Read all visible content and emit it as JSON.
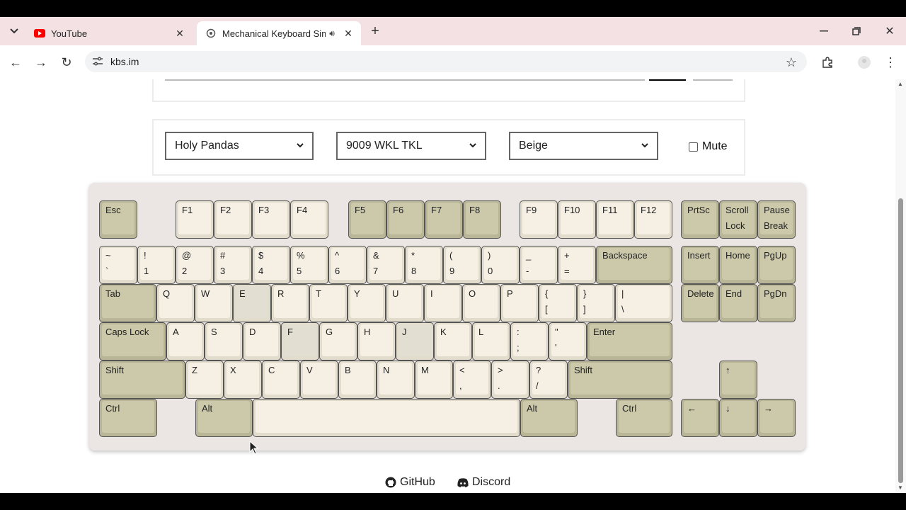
{
  "browser": {
    "tabs": [
      {
        "title": "YouTube",
        "icon": "youtube-icon"
      },
      {
        "title": "Mechanical Keyboard Simul",
        "icon": "keyboard-favicon-icon",
        "audio": true
      }
    ],
    "url": "kbs.im"
  },
  "controls": {
    "switch_select": "Holy Pandas",
    "layout_select": "9009 WKL TKL",
    "color_select": "Beige",
    "mute_label": "Mute",
    "mute_checked": false
  },
  "keyboard": {
    "colors": {
      "alpha": "#f6f0e4",
      "modifier": "#ccc9ab",
      "pressed": "#e2ded2"
    },
    "keys": [
      {
        "id": "esc",
        "t1": "Esc",
        "t2": ""
      },
      {
        "id": "f1",
        "t1": "F1",
        "t2": ""
      },
      {
        "id": "f2",
        "t1": "F2",
        "t2": ""
      },
      {
        "id": "f3",
        "t1": "F3",
        "t2": ""
      },
      {
        "id": "f4",
        "t1": "F4",
        "t2": ""
      },
      {
        "id": "f5",
        "t1": "F5",
        "t2": ""
      },
      {
        "id": "f6",
        "t1": "F6",
        "t2": ""
      },
      {
        "id": "f7",
        "t1": "F7",
        "t2": ""
      },
      {
        "id": "f8",
        "t1": "F8",
        "t2": ""
      },
      {
        "id": "f9",
        "t1": "F9",
        "t2": ""
      },
      {
        "id": "f10",
        "t1": "F10",
        "t2": ""
      },
      {
        "id": "f11",
        "t1": "F11",
        "t2": ""
      },
      {
        "id": "f12",
        "t1": "F12",
        "t2": ""
      },
      {
        "id": "prtsc",
        "t1": "PrtSc",
        "t2": ""
      },
      {
        "id": "scrolllock",
        "t1": "Scroll",
        "t2": "Lock"
      },
      {
        "id": "pause",
        "t1": "Pause",
        "t2": "Break"
      },
      {
        "id": "backtick",
        "t1": "~",
        "t2": "`"
      },
      {
        "id": "d1",
        "t1": "!",
        "t2": "1"
      },
      {
        "id": "d2",
        "t1": "@",
        "t2": "2"
      },
      {
        "id": "d3",
        "t1": "#",
        "t2": "3"
      },
      {
        "id": "d4",
        "t1": "$",
        "t2": "4"
      },
      {
        "id": "d5",
        "t1": "%",
        "t2": "5"
      },
      {
        "id": "d6",
        "t1": "^",
        "t2": "6"
      },
      {
        "id": "d7",
        "t1": "&",
        "t2": "7"
      },
      {
        "id": "d8",
        "t1": "*",
        "t2": "8"
      },
      {
        "id": "d9",
        "t1": "(",
        "t2": "9"
      },
      {
        "id": "d0",
        "t1": ")",
        "t2": "0"
      },
      {
        "id": "minus",
        "t1": "_",
        "t2": "-"
      },
      {
        "id": "equal",
        "t1": "+",
        "t2": "="
      },
      {
        "id": "backspace",
        "t1": "Backspace",
        "t2": ""
      },
      {
        "id": "insert",
        "t1": "Insert",
        "t2": ""
      },
      {
        "id": "home",
        "t1": "Home",
        "t2": ""
      },
      {
        "id": "pgup",
        "t1": "PgUp",
        "t2": ""
      },
      {
        "id": "tab",
        "t1": "Tab",
        "t2": ""
      },
      {
        "id": "q",
        "t1": "Q",
        "t2": ""
      },
      {
        "id": "w",
        "t1": "W",
        "t2": ""
      },
      {
        "id": "e",
        "t1": "E",
        "t2": ""
      },
      {
        "id": "r",
        "t1": "R",
        "t2": ""
      },
      {
        "id": "t",
        "t1": "T",
        "t2": ""
      },
      {
        "id": "y",
        "t1": "Y",
        "t2": ""
      },
      {
        "id": "u",
        "t1": "U",
        "t2": ""
      },
      {
        "id": "i",
        "t1": "I",
        "t2": ""
      },
      {
        "id": "o",
        "t1": "O",
        "t2": ""
      },
      {
        "id": "p",
        "t1": "P",
        "t2": ""
      },
      {
        "id": "lbracket",
        "t1": "{",
        "t2": "["
      },
      {
        "id": "rbracket",
        "t1": "}",
        "t2": "]"
      },
      {
        "id": "backslash",
        "t1": "|",
        "t2": "\\"
      },
      {
        "id": "delete",
        "t1": "Delete",
        "t2": ""
      },
      {
        "id": "end",
        "t1": "End",
        "t2": ""
      },
      {
        "id": "pgdn",
        "t1": "PgDn",
        "t2": ""
      },
      {
        "id": "capslock",
        "t1": "Caps Lock",
        "t2": ""
      },
      {
        "id": "a",
        "t1": "A",
        "t2": ""
      },
      {
        "id": "s",
        "t1": "S",
        "t2": ""
      },
      {
        "id": "d",
        "t1": "D",
        "t2": ""
      },
      {
        "id": "f",
        "t1": "F",
        "t2": ""
      },
      {
        "id": "g",
        "t1": "G",
        "t2": ""
      },
      {
        "id": "h",
        "t1": "H",
        "t2": ""
      },
      {
        "id": "j",
        "t1": "J",
        "t2": ""
      },
      {
        "id": "k",
        "t1": "K",
        "t2": ""
      },
      {
        "id": "l",
        "t1": "L",
        "t2": ""
      },
      {
        "id": "semicolon",
        "t1": ":",
        "t2": ";"
      },
      {
        "id": "quote",
        "t1": "\"",
        "t2": "'"
      },
      {
        "id": "enter",
        "t1": "Enter",
        "t2": ""
      },
      {
        "id": "lshift",
        "t1": "Shift",
        "t2": ""
      },
      {
        "id": "z",
        "t1": "Z",
        "t2": ""
      },
      {
        "id": "x",
        "t1": "X",
        "t2": ""
      },
      {
        "id": "c",
        "t1": "C",
        "t2": ""
      },
      {
        "id": "v",
        "t1": "V",
        "t2": ""
      },
      {
        "id": "b",
        "t1": "B",
        "t2": ""
      },
      {
        "id": "n",
        "t1": "N",
        "t2": ""
      },
      {
        "id": "m",
        "t1": "M",
        "t2": ""
      },
      {
        "id": "comma",
        "t1": "<",
        "t2": ","
      },
      {
        "id": "period",
        "t1": ">",
        "t2": "."
      },
      {
        "id": "slash",
        "t1": "?",
        "t2": "/"
      },
      {
        "id": "rshift",
        "t1": "Shift",
        "t2": ""
      },
      {
        "id": "up",
        "t1": "↑",
        "t2": ""
      },
      {
        "id": "lctrl",
        "t1": "Ctrl",
        "t2": ""
      },
      {
        "id": "lalt",
        "t1": "Alt",
        "t2": ""
      },
      {
        "id": "space",
        "t1": "",
        "t2": ""
      },
      {
        "id": "ralt",
        "t1": "Alt",
        "t2": ""
      },
      {
        "id": "rctrl",
        "t1": "Ctrl",
        "t2": ""
      },
      {
        "id": "left",
        "t1": "←",
        "t2": ""
      },
      {
        "id": "down",
        "t1": "↓",
        "t2": ""
      },
      {
        "id": "right",
        "t1": "→",
        "t2": ""
      }
    ]
  },
  "footer": {
    "github_label": "GitHub",
    "discord_label": "Discord"
  }
}
